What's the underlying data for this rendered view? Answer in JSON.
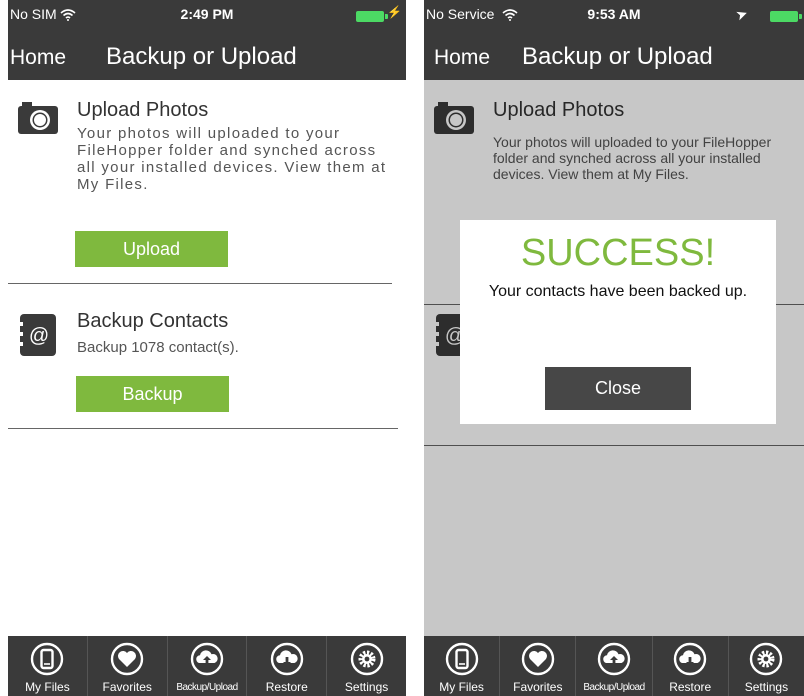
{
  "left": {
    "status": {
      "carrier": "No SIM",
      "time": "2:49 PM"
    },
    "nav": {
      "home": "Home",
      "title": "Backup or Upload"
    },
    "upload": {
      "title": "Upload Photos",
      "desc": "Your photos will uploaded to your FileHopper folder and synched across all your installed devices. View them at My Files.",
      "button": "Upload"
    },
    "backup": {
      "title": "Backup Contacts",
      "desc": "Backup 1078 contact(s).",
      "button": "Backup"
    }
  },
  "right": {
    "status": {
      "carrier": "No Service",
      "time": "9:53 AM"
    },
    "nav": {
      "home": "Home",
      "title": "Backup or Upload"
    },
    "upload": {
      "title": "Upload Photos",
      "desc": "Your photos will uploaded to your FileHopper folder and synched across all your installed devices. View them at My Files."
    },
    "dialog": {
      "title": "SUCCESS!",
      "message": "Your contacts have been backed up.",
      "close": "Close"
    }
  },
  "tabs": [
    {
      "label": "My Files",
      "icon": "phone-icon"
    },
    {
      "label": "Favorites",
      "icon": "heart-icon"
    },
    {
      "label": "Backup/Upload",
      "icon": "cloud-upload-icon"
    },
    {
      "label": "Restore",
      "icon": "cloud-download-icon"
    },
    {
      "label": "Settings",
      "icon": "gear-icon"
    }
  ],
  "colors": {
    "bar": "#3a3a3a",
    "accent": "#7fb93e",
    "battery": "#4cd964"
  }
}
